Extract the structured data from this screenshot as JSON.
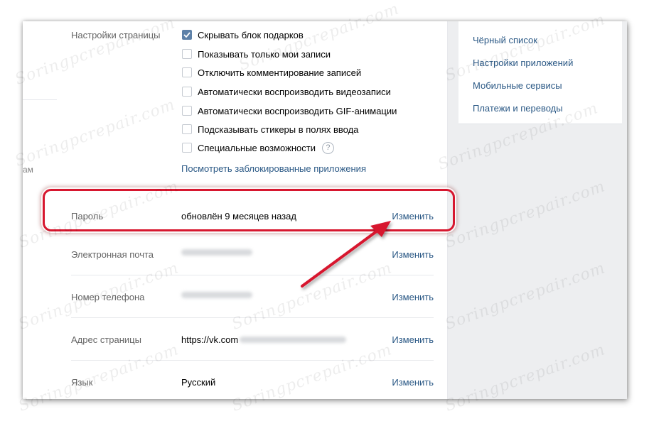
{
  "left_strip": {
    "fragment": "ам"
  },
  "page_settings": {
    "label": "Настройки страницы",
    "options": [
      {
        "label": "Скрывать блок подарков",
        "checked": true
      },
      {
        "label": "Показывать только мои записи",
        "checked": false
      },
      {
        "label": "Отключить комментирование записей",
        "checked": false
      },
      {
        "label": "Автоматически воспроизводить видеозаписи",
        "checked": false
      },
      {
        "label": "Автоматически воспроизводить GIF-анимации",
        "checked": false
      },
      {
        "label": "Подсказывать стикеры в полях ввода",
        "checked": false
      },
      {
        "label": "Специальные возможности",
        "checked": false,
        "help": "?"
      }
    ],
    "blocked_apps_link": "Посмотреть заблокированные приложения"
  },
  "rows": [
    {
      "label": "Пароль",
      "value": "обновлён 9 месяцев назад",
      "action": "Изменить"
    },
    {
      "label": "Электронная почта",
      "value": "",
      "action": "Изменить"
    },
    {
      "label": "Номер телефона",
      "value": "",
      "action": "Изменить"
    },
    {
      "label": "Адрес страницы",
      "value": "https://vk.com",
      "action": "Изменить"
    },
    {
      "label": "Язык",
      "value": "Русский",
      "action": "Изменить"
    }
  ],
  "right_menu": [
    "Чёрный список",
    "Настройки приложений",
    "Мобильные сервисы",
    "Платежи и переводы"
  ],
  "watermark": "Soringpcrepair.com",
  "colors": {
    "link": "#2a5885",
    "highlight": "#d7172f",
    "checkbox": "#5e81a8"
  }
}
